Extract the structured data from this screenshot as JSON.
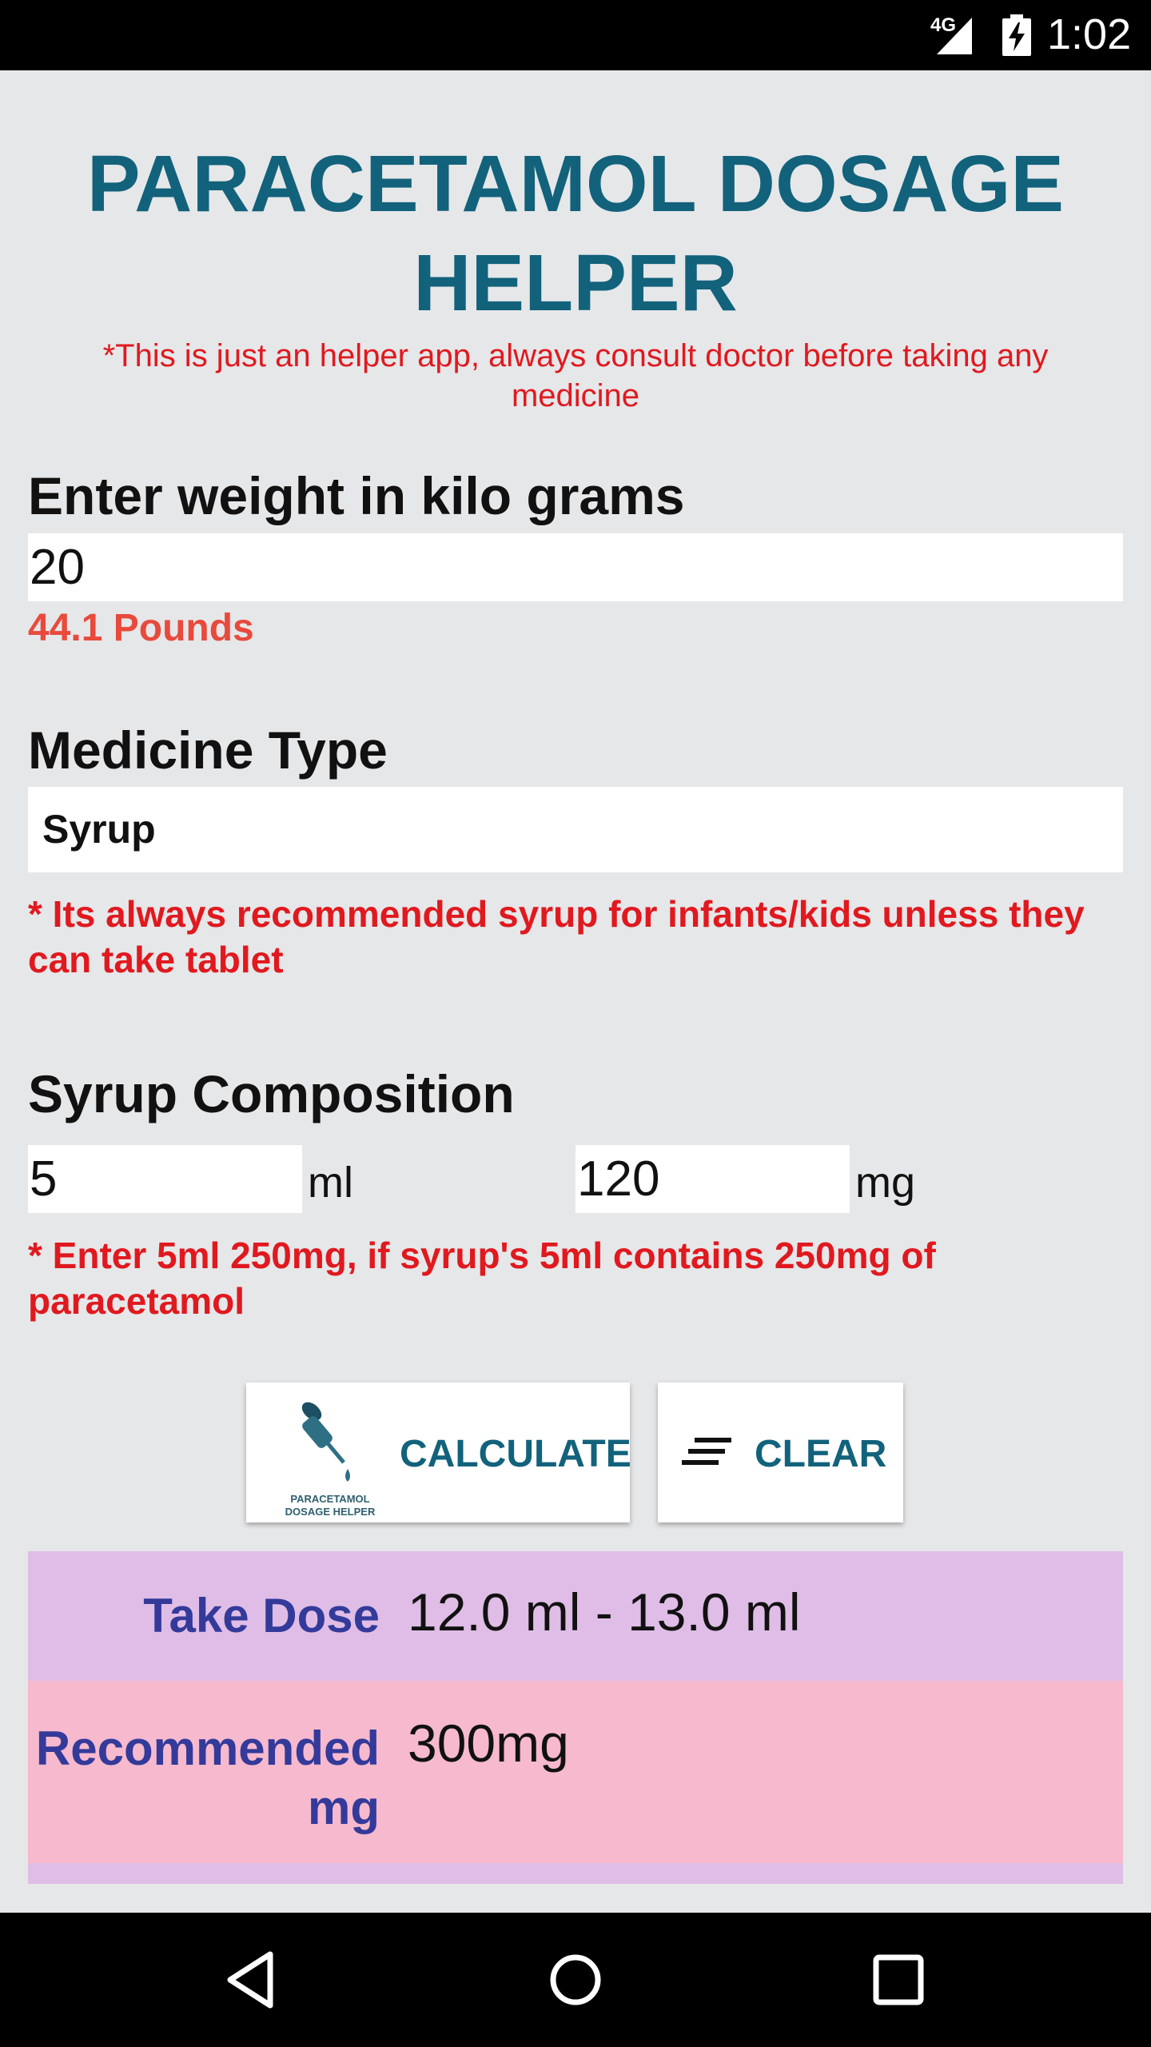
{
  "status_bar": {
    "network": "4G",
    "time": "1:02"
  },
  "header": {
    "title": "PARACETAMOL DOSAGE HELPER",
    "disclaimer": "*This is just an helper app, always consult doctor before taking any medicine"
  },
  "weight": {
    "label": "Enter weight in kilo grams",
    "value": "20",
    "pounds": "44.1 Pounds"
  },
  "medicine": {
    "label": "Medicine Type",
    "selected": "Syrup",
    "note": "* Its always recommended syrup for infants/kids unless they can take tablet"
  },
  "composition": {
    "label": "Syrup Composition",
    "ml_value": "5",
    "ml_unit": "ml",
    "mg_value": "120",
    "mg_unit": "mg",
    "note": "* Enter 5ml 250mg, if syrup's 5ml contains 250mg of paracetamol"
  },
  "buttons": {
    "logo_caption_1": "PARACETAMOL",
    "logo_caption_2": "DOSAGE HELPER",
    "calculate": "CALCULATE",
    "clear": "CLEAR"
  },
  "results": {
    "dose_label": "Take Dose",
    "dose_value": "12.0 ml - 13.0 ml",
    "mg_label_1": "Recommended",
    "mg_label_2": "mg",
    "mg_value": "300mg"
  },
  "colors": {
    "accent": "#12627b",
    "warning": "#e0191f",
    "pounds": "#e84a3c",
    "result_label": "#333a9a",
    "dose_row_bg": "#dfbde6",
    "mg_row_bg": "#f6b9cd"
  },
  "nav": {
    "back_icon": "back-triangle-icon",
    "home_icon": "home-circle-icon",
    "recents_icon": "recents-square-icon"
  }
}
